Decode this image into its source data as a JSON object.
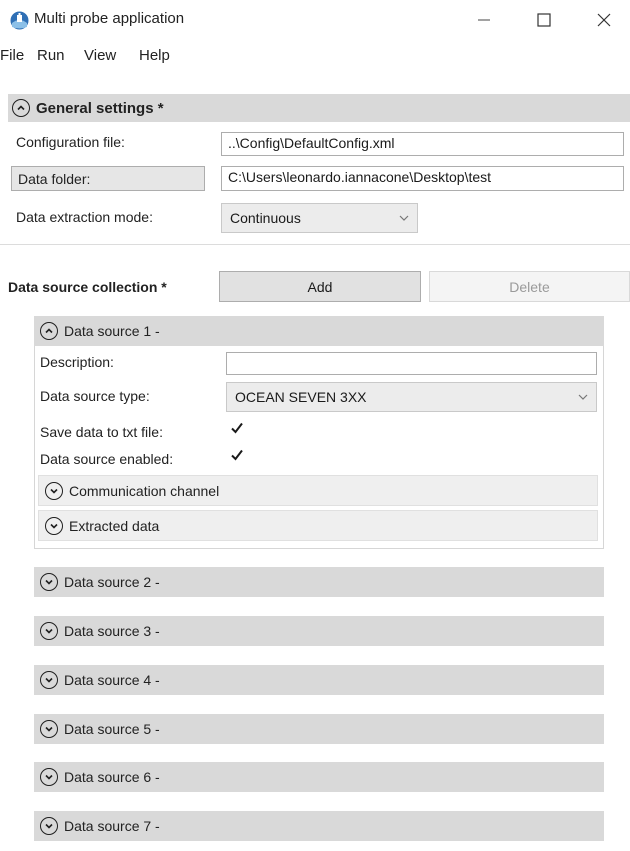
{
  "window": {
    "title": "Multi probe application"
  },
  "menu": [
    "File",
    "Run",
    "View",
    "Help"
  ],
  "general": {
    "title": "General settings *",
    "config_label": "Configuration file:",
    "config_value": "..\\Config\\DefaultConfig.xml",
    "folder_label": "Data folder:",
    "folder_value": "C:\\Users\\leonardo.iannacone\\Desktop\\test",
    "mode_label": "Data extraction mode:",
    "mode_value": "Continuous"
  },
  "collection": {
    "label": "Data source collection *",
    "add_label": "Add",
    "delete_label": "Delete"
  },
  "ds1": {
    "title": "Data source 1 -",
    "description_label": "Description:",
    "description_value": "",
    "type_label": "Data source type:",
    "type_value": "OCEAN SEVEN 3XX",
    "save_label": "Save data to txt file:",
    "save_checked": true,
    "enabled_label": "Data source enabled:",
    "enabled_checked": true,
    "comm_label": "Communication channel",
    "extract_label": "Extracted data"
  },
  "sources": [
    "Data source 2 -",
    "Data source 3 -",
    "Data source 4 -",
    "Data source 5 -",
    "Data source 6 -",
    "Data source 7 -"
  ]
}
